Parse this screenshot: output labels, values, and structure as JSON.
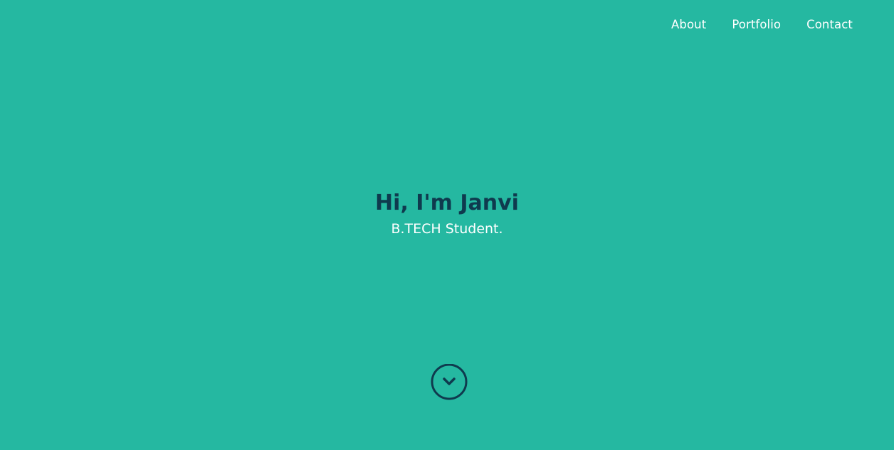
{
  "nav": {
    "items": [
      {
        "label": "About"
      },
      {
        "label": "Portfolio"
      },
      {
        "label": "Contact"
      }
    ]
  },
  "hero": {
    "title": "Hi, I'm Janvi",
    "subtitle": "B.TECH Student."
  },
  "scroll_button": {
    "icon": "chevron-down-circle-icon"
  },
  "colors": {
    "background": "#25b8a1",
    "heading": "#0f3a4e",
    "text": "#ffffff"
  }
}
